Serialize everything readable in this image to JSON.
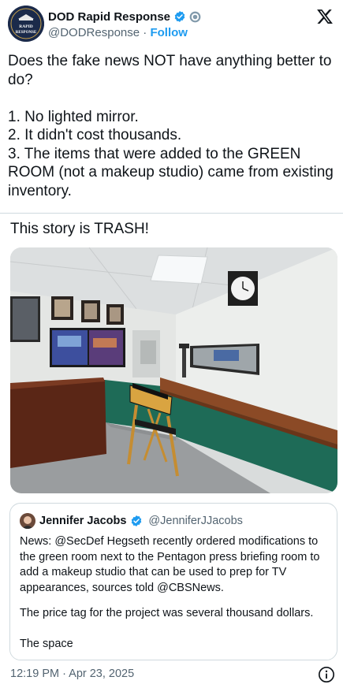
{
  "author": {
    "display_name": "DOD Rapid Response",
    "handle": "@DODResponse",
    "separator": " · ",
    "follow_label": "Follow",
    "avatar_text_top": "RAPID",
    "avatar_text_bottom": "RESPONSE",
    "icons": [
      "verified-badge-icon",
      "government-badge-icon",
      "x-logo-icon"
    ]
  },
  "tweet": {
    "lines": [
      "Does the fake news NOT have anything better to do?",
      "1. No lighted mirror.",
      "2. It didn't cost thousands.",
      "3. The items that were added to the GREEN ROOM (not a makeup studio) came from existing inventory."
    ],
    "quote_comment": "This story is TRASH!",
    "timestamp": "12:19 PM · Apr 23, 2025"
  },
  "quoted_post": {
    "display_name": "Jennifer Jacobs",
    "handle": "@JenniferJJacobs",
    "body": "News: @SecDef Hegseth recently ordered modifications to the green room next to the Pentagon press briefing room to add a makeup studio that can be used to prep for TV appearances, sources told @CBSNews.",
    "continuation_1": "The price tag for the project was several thousand dollars.",
    "continuation_2": "The space"
  },
  "colors": {
    "link": "#1d9bf0",
    "secondary_text": "#536471",
    "border": "#cfd9de",
    "wall_green": "#1e6b57",
    "wood": "#8b4a26"
  }
}
